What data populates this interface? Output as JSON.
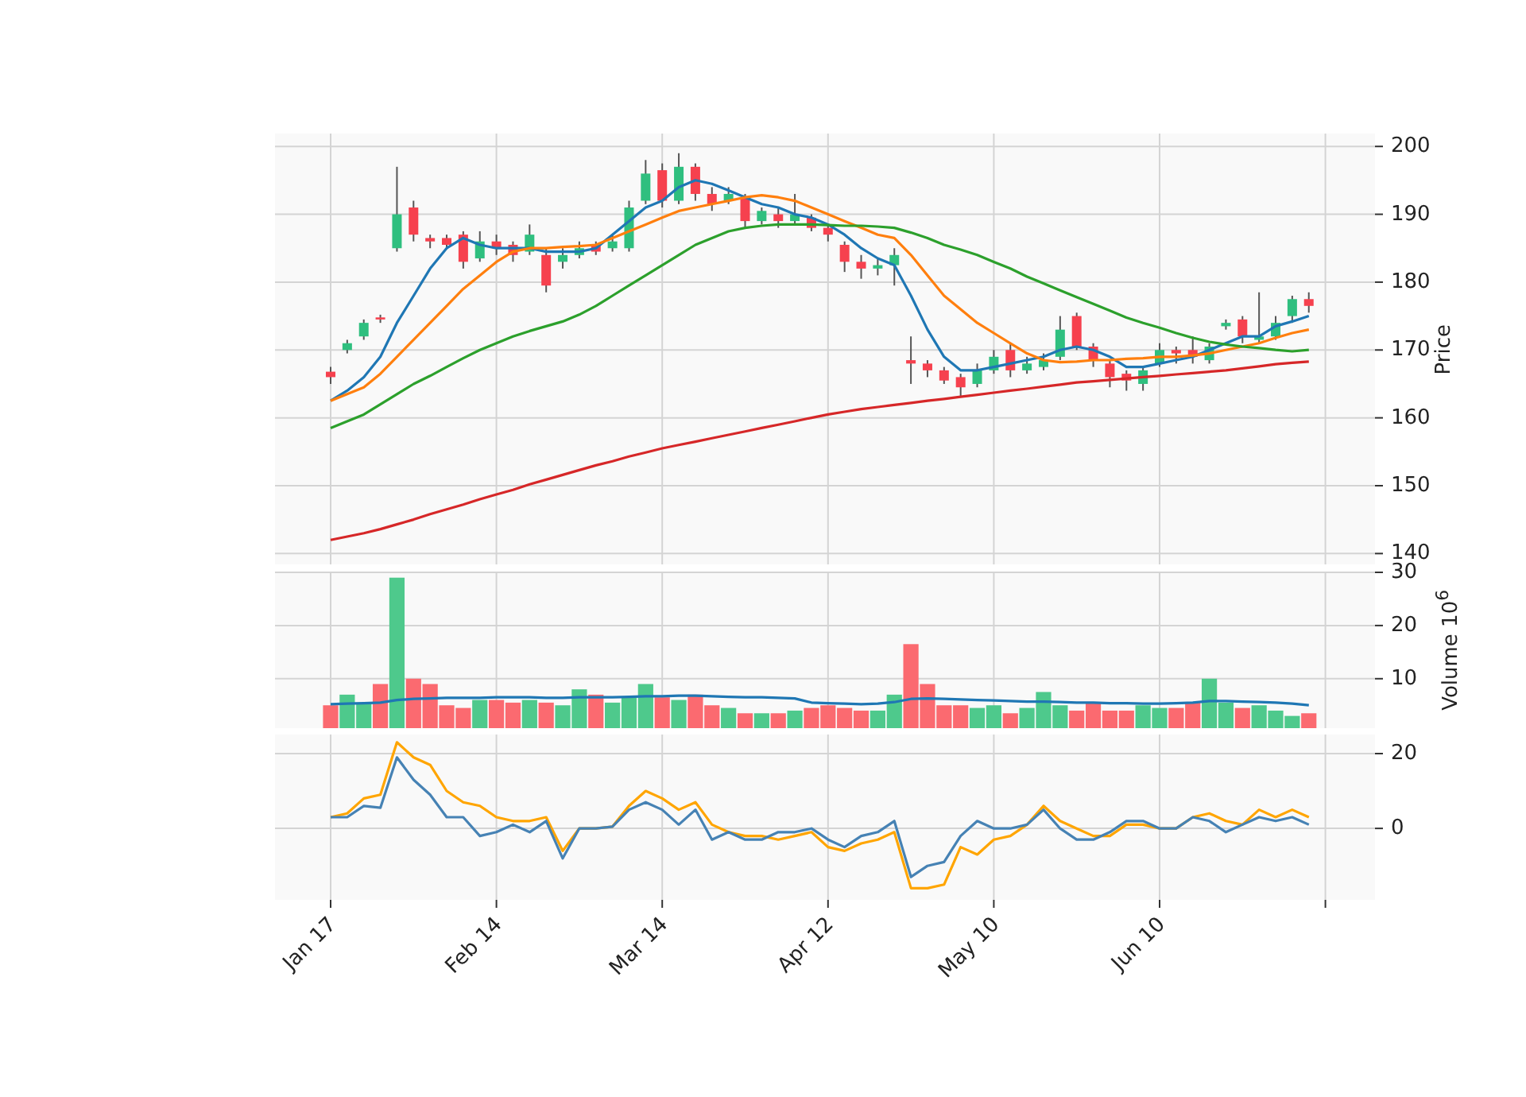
{
  "figure": {
    "panels": [
      {
        "kind": "price",
        "chart_data": {
          "type": "candlestick",
          "ylabel": "Price",
          "grid": true,
          "ylim": [
            138.4,
            201.9
          ],
          "yticks": [
            {
              "value": 140,
              "label": "140"
            },
            {
              "value": 150,
              "label": "150"
            },
            {
              "value": 160,
              "label": "160"
            },
            {
              "value": 170,
              "label": "170"
            },
            {
              "value": 180,
              "label": "180"
            },
            {
              "value": 190,
              "label": "190"
            },
            {
              "value": 200,
              "label": "200"
            }
          ],
          "ohlc": [
            [
              166.8,
              167.5,
              165,
              166
            ],
            [
              170,
              171.5,
              169.5,
              171
            ],
            [
              172,
              174.5,
              171.5,
              174
            ],
            [
              174.8,
              175.2,
              174,
              174.5
            ],
            [
              185,
              197,
              184.5,
              190
            ],
            [
              191,
              192,
              186,
              187
            ],
            [
              186.5,
              187,
              185,
              186
            ],
            [
              186.5,
              187,
              185,
              185.5
            ],
            [
              187,
              187.5,
              182,
              183
            ],
            [
              183.5,
              187.5,
              183,
              186
            ],
            [
              186,
              187,
              184,
              185
            ],
            [
              185.5,
              186,
              183,
              184
            ],
            [
              184.5,
              188.5,
              184,
              187
            ],
            [
              184,
              185,
              178.5,
              179.5
            ],
            [
              183,
              185,
              182,
              184
            ],
            [
              184,
              186,
              183.5,
              185
            ],
            [
              185.5,
              186,
              184,
              184.5
            ],
            [
              185,
              187,
              184.5,
              186
            ],
            [
              185,
              192,
              184.5,
              191
            ],
            [
              192,
              198,
              191.5,
              196
            ],
            [
              196.5,
              197.5,
              191,
              192
            ],
            [
              192,
              199,
              191.5,
              197
            ],
            [
              197,
              197.5,
              192,
              193
            ],
            [
              193,
              194,
              190.5,
              191.5
            ],
            [
              192,
              194,
              191.5,
              193
            ],
            [
              192.5,
              193,
              188,
              189
            ],
            [
              189,
              191,
              188.5,
              190.5
            ],
            [
              190,
              191,
              188,
              189
            ],
            [
              189,
              193,
              188.5,
              190
            ],
            [
              189.5,
              190,
              187.5,
              188
            ],
            [
              188,
              188.5,
              186,
              187
            ],
            [
              185.5,
              186,
              181.5,
              183
            ],
            [
              183,
              184,
              180.5,
              182
            ],
            [
              182,
              183.5,
              181,
              182.5
            ],
            [
              182.5,
              185,
              179.5,
              184
            ],
            [
              168.5,
              172,
              165,
              168
            ],
            [
              168,
              168.5,
              166,
              167
            ],
            [
              167,
              167.5,
              165,
              165.5
            ],
            [
              166,
              166.5,
              163,
              164.5
            ],
            [
              165,
              168,
              164.5,
              167
            ],
            [
              167,
              170,
              166.5,
              169
            ],
            [
              170,
              171,
              166,
              167
            ],
            [
              167,
              169,
              166.5,
              168
            ],
            [
              167.5,
              169.5,
              167,
              168.5
            ],
            [
              169,
              175,
              168.5,
              173
            ],
            [
              175,
              175.5,
              170,
              170.5
            ],
            [
              170.5,
              171,
              167.5,
              168.5
            ],
            [
              168,
              168.5,
              164.5,
              166
            ],
            [
              166.5,
              167,
              164,
              165.5
            ],
            [
              165,
              167.5,
              164,
              167
            ],
            [
              168,
              171,
              167.5,
              170
            ],
            [
              170,
              170.5,
              168,
              169.5
            ],
            [
              170,
              172,
              168,
              169
            ],
            [
              168.5,
              171,
              168,
              170.5
            ],
            [
              173.5,
              174.5,
              173,
              174
            ],
            [
              174.5,
              175,
              171,
              172
            ],
            [
              171.5,
              178.5,
              171,
              172
            ],
            [
              172,
              175,
              171.5,
              174
            ],
            [
              175,
              178,
              174,
              177.5
            ],
            [
              177.5,
              178.5,
              175.5,
              176.5
            ]
          ],
          "series": [
            {
              "type": "line",
              "color": "#1f77b4",
              "values": [
                162.5,
                164,
                166,
                169,
                174,
                178,
                182,
                185,
                186.5,
                185.5,
                185,
                185,
                185,
                184.5,
                184.5,
                184.5,
                185,
                187,
                189,
                191,
                192,
                194,
                195,
                194.5,
                193.5,
                192.5,
                191.5,
                191,
                190,
                189.5,
                188.5,
                187,
                185,
                183.5,
                182.5,
                178,
                173,
                169,
                167,
                167,
                167.5,
                168,
                168.5,
                169,
                170,
                170.5,
                170,
                169,
                167.5,
                167.5,
                168,
                168.5,
                169,
                170,
                171,
                172,
                172,
                173.5,
                174.2,
                175
              ]
            },
            {
              "type": "line",
              "color": "#ff7f0e",
              "values": [
                162.5,
                163.5,
                164.5,
                166.5,
                169,
                171.5,
                174,
                176.5,
                179,
                181,
                183,
                184.5,
                185,
                185,
                185.2,
                185.3,
                185.5,
                186.5,
                187.5,
                188.5,
                189.5,
                190.5,
                191,
                191.5,
                192,
                192.5,
                192.8,
                192.5,
                192,
                191,
                190,
                189,
                188,
                187,
                186.5,
                184,
                181,
                178,
                176,
                174,
                172.5,
                171,
                169.5,
                168.5,
                168.2,
                168.3,
                168.5,
                168.5,
                168.7,
                168.8,
                169,
                169,
                169.2,
                169.5,
                170,
                170.5,
                171,
                171.8,
                172.5,
                173
              ]
            },
            {
              "type": "line",
              "color": "#2ca02c",
              "values": [
                158.5,
                159.5,
                160.5,
                162,
                163.5,
                165,
                166.2,
                167.5,
                168.8,
                170,
                171,
                172,
                172.8,
                173.5,
                174.2,
                175.2,
                176.5,
                178,
                179.5,
                181,
                182.5,
                184,
                185.5,
                186.5,
                187.5,
                188,
                188.3,
                188.5,
                188.5,
                188.5,
                188.4,
                188.3,
                188.3,
                188.2,
                188,
                187.3,
                186.5,
                185.5,
                184.8,
                184,
                183,
                182,
                180.8,
                179.8,
                178.8,
                177.8,
                176.8,
                175.8,
                174.8,
                174,
                173.3,
                172.5,
                171.8,
                171.2,
                170.8,
                170.5,
                170.3,
                170,
                169.8,
                170
              ]
            },
            {
              "type": "line",
              "color": "#d62728",
              "values": [
                142,
                142.5,
                143,
                143.6,
                144.3,
                145,
                145.8,
                146.5,
                147.2,
                148,
                148.7,
                149.4,
                150.2,
                150.9,
                151.6,
                152.3,
                153,
                153.6,
                154.3,
                154.9,
                155.5,
                156,
                156.5,
                157,
                157.5,
                158,
                158.5,
                159,
                159.5,
                160,
                160.5,
                160.9,
                161.3,
                161.6,
                161.9,
                162.2,
                162.5,
                162.8,
                163.1,
                163.4,
                163.7,
                164,
                164.3,
                164.6,
                164.9,
                165.2,
                165.4,
                165.6,
                165.8,
                166,
                166.2,
                166.4,
                166.6,
                166.8,
                167,
                167.3,
                167.6,
                167.9,
                168.1,
                168.3
              ]
            }
          ]
        }
      },
      {
        "kind": "volume",
        "chart_data": {
          "type": "bar",
          "ylabel": "Volume  10$^{6}$",
          "grid": true,
          "ylim": [
            0.7,
            30
          ],
          "yticks": [
            {
              "value": 10,
              "label": "10"
            },
            {
              "value": 20,
              "label": "20"
            },
            {
              "value": 30,
              "label": "30"
            }
          ],
          "series": [
            {
              "type": "bar",
              "colors": [
                "#fb6a70",
                "#4ec98c",
                "#4ec98c",
                "#fb6a70",
                "#4ec98c",
                "#fb6a70",
                "#fb6a70",
                "#fb6a70",
                "#fb6a70",
                "#4ec98c",
                "#fb6a70",
                "#fb6a70",
                "#4ec98c",
                "#fb6a70",
                "#4ec98c",
                "#4ec98c",
                "#fb6a70",
                "#4ec98c",
                "#4ec98c",
                "#4ec98c",
                "#fb6a70",
                "#4ec98c",
                "#fb6a70",
                "#fb6a70",
                "#4ec98c",
                "#fb6a70",
                "#4ec98c",
                "#fb6a70",
                "#4ec98c",
                "#fb6a70",
                "#fb6a70",
                "#fb6a70",
                "#fb6a70",
                "#4ec98c",
                "#4ec98c",
                "#fb6a70",
                "#fb6a70",
                "#fb6a70",
                "#fb6a70",
                "#4ec98c",
                "#4ec98c",
                "#fb6a70",
                "#4ec98c",
                "#4ec98c",
                "#4ec98c",
                "#fb6a70",
                "#fb6a70",
                "#fb6a70",
                "#fb6a70",
                "#4ec98c",
                "#4ec98c",
                "#fb6a70",
                "#fb6a70",
                "#4ec98c",
                "#4ec98c",
                "#fb6a70",
                "#4ec98c",
                "#4ec98c",
                "#4ec98c",
                "#fb6a70"
              ],
              "values": [
                5,
                7,
                5.5,
                9,
                29,
                10,
                9,
                5,
                4.5,
                6,
                6,
                5.5,
                6,
                5.5,
                5,
                8,
                7,
                5.5,
                6.5,
                9,
                6.5,
                6,
                7,
                5,
                4.5,
                3.5,
                3.5,
                3.5,
                4,
                4.5,
                5,
                4.5,
                4,
                4,
                7,
                16.5,
                9,
                5,
                5,
                4.5,
                5,
                3.5,
                4.5,
                7.5,
                5,
                4,
                5.5,
                4,
                4,
                5,
                4.5,
                4.5,
                5.5,
                10,
                5.5,
                4.5,
                5,
                4,
                3,
                3.5
              ]
            },
            {
              "type": "line",
              "color": "#1f77b4",
              "values": [
                5.2,
                5.3,
                5.4,
                5.5,
                6,
                6.2,
                6.3,
                6.4,
                6.4,
                6.4,
                6.5,
                6.5,
                6.5,
                6.4,
                6.4,
                6.5,
                6.5,
                6.5,
                6.6,
                6.7,
                6.7,
                6.8,
                6.8,
                6.7,
                6.6,
                6.5,
                6.5,
                6.4,
                6.3,
                5.5,
                5.4,
                5.3,
                5.2,
                5.3,
                5.6,
                6.2,
                6.3,
                6.2,
                6.1,
                6,
                5.9,
                5.8,
                5.7,
                5.7,
                5.6,
                5.5,
                5.5,
                5.4,
                5.4,
                5.3,
                5.3,
                5.4,
                5.5,
                5.8,
                5.8,
                5.7,
                5.6,
                5.5,
                5.3,
                5
              ]
            }
          ]
        }
      },
      {
        "kind": "oscillator",
        "chart_data": {
          "type": "line",
          "grid": true,
          "ylim": [
            -19.1,
            25.1
          ],
          "yticks": [
            {
              "value": 0,
              "label": "0"
            },
            {
              "value": 20,
              "label": "20"
            }
          ],
          "categories": [
            "Jan 17",
            null,
            null,
            null,
            null,
            null,
            null,
            null,
            null,
            null,
            "Feb 14",
            null,
            null,
            null,
            null,
            null,
            null,
            null,
            null,
            null,
            "Mar 14",
            null,
            null,
            null,
            null,
            null,
            null,
            null,
            null,
            null,
            "Apr 12",
            null,
            null,
            null,
            null,
            null,
            null,
            null,
            null,
            null,
            "May 10",
            null,
            null,
            null,
            null,
            null,
            null,
            null,
            null,
            null,
            "Jun 10",
            null,
            null,
            null,
            null,
            null,
            null,
            null,
            null,
            null
          ],
          "series": [
            {
              "color": "#ffa500",
              "values": [
                3,
                4,
                8,
                9,
                23,
                19,
                17,
                10,
                7,
                6,
                3,
                2,
                2,
                3,
                -6,
                0,
                0,
                0.5,
                6,
                10,
                8,
                5,
                7,
                1,
                -1,
                -2,
                -2,
                -3,
                -2,
                -1,
                -5,
                -6,
                -4,
                -3,
                -1,
                -16,
                -16,
                -15,
                -5,
                -7,
                -3,
                -2,
                1,
                6,
                2,
                0,
                -2,
                -2,
                1,
                1,
                0,
                0,
                3,
                4,
                2,
                1,
                5,
                3,
                5,
                3
              ]
            },
            {
              "color": "#4682b4",
              "values": [
                3,
                3,
                6,
                5.5,
                19,
                13,
                9,
                3,
                3,
                -2,
                -1,
                1,
                -1,
                2,
                -8,
                0,
                0,
                0.5,
                5,
                7,
                5,
                1,
                5,
                -3,
                -1,
                -3,
                -3,
                -1,
                -1,
                0,
                -3,
                -5,
                -2,
                -1,
                2,
                -13,
                -10,
                -9,
                -2,
                2,
                0,
                0,
                1,
                5,
                0,
                -3,
                -3,
                -1,
                2,
                2,
                0,
                0,
                3,
                2,
                -1,
                1,
                3,
                2,
                3,
                1
              ]
            }
          ]
        }
      }
    ]
  }
}
